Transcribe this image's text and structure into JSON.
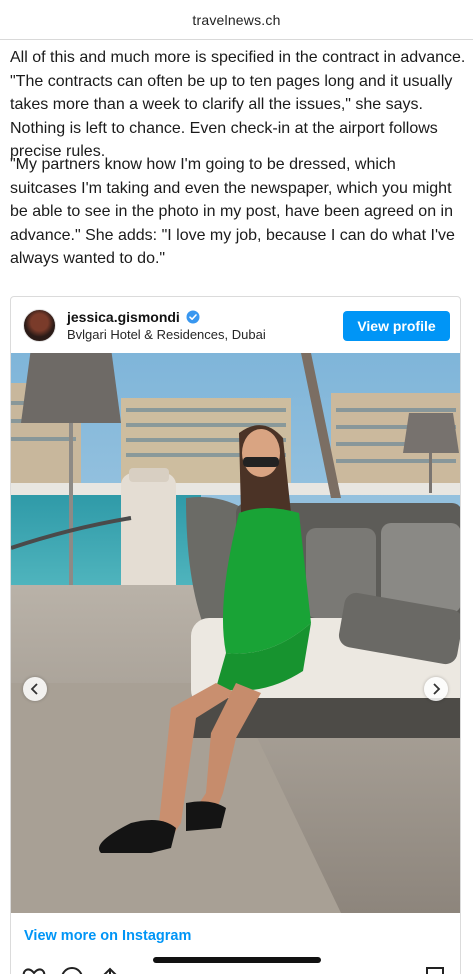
{
  "site": {
    "domain": "travelnews.ch"
  },
  "article": {
    "paragraph_1": "All of this and much more is specified in the contract in advance. \"The contracts can often be up to ten pages long and it usually takes more than a week to clarify all the issues,\" she says. Nothing is left to chance. Even check-in at the airport follows precise rules.",
    "paragraph_2": "\"My partners know how I'm going to be dressed, which suitcases I'm taking and even the newspaper, which you might be able to see in the photo in my post, have been agreed on in advance.\" She adds: \"I love my job, because I can do what I've always wanted to do.\""
  },
  "instagram_embed": {
    "username": "jessica.gismondi",
    "location": "Bvlgari Hotel & Residences, Dubai",
    "view_profile_label": "View profile",
    "view_more_label": "View more on Instagram",
    "accent_color": "#0095f6",
    "icons": [
      "verified-badge-icon",
      "chevron-left-icon",
      "chevron-right-icon",
      "heart-icon",
      "comment-icon",
      "share-icon",
      "bookmark-icon"
    ]
  }
}
